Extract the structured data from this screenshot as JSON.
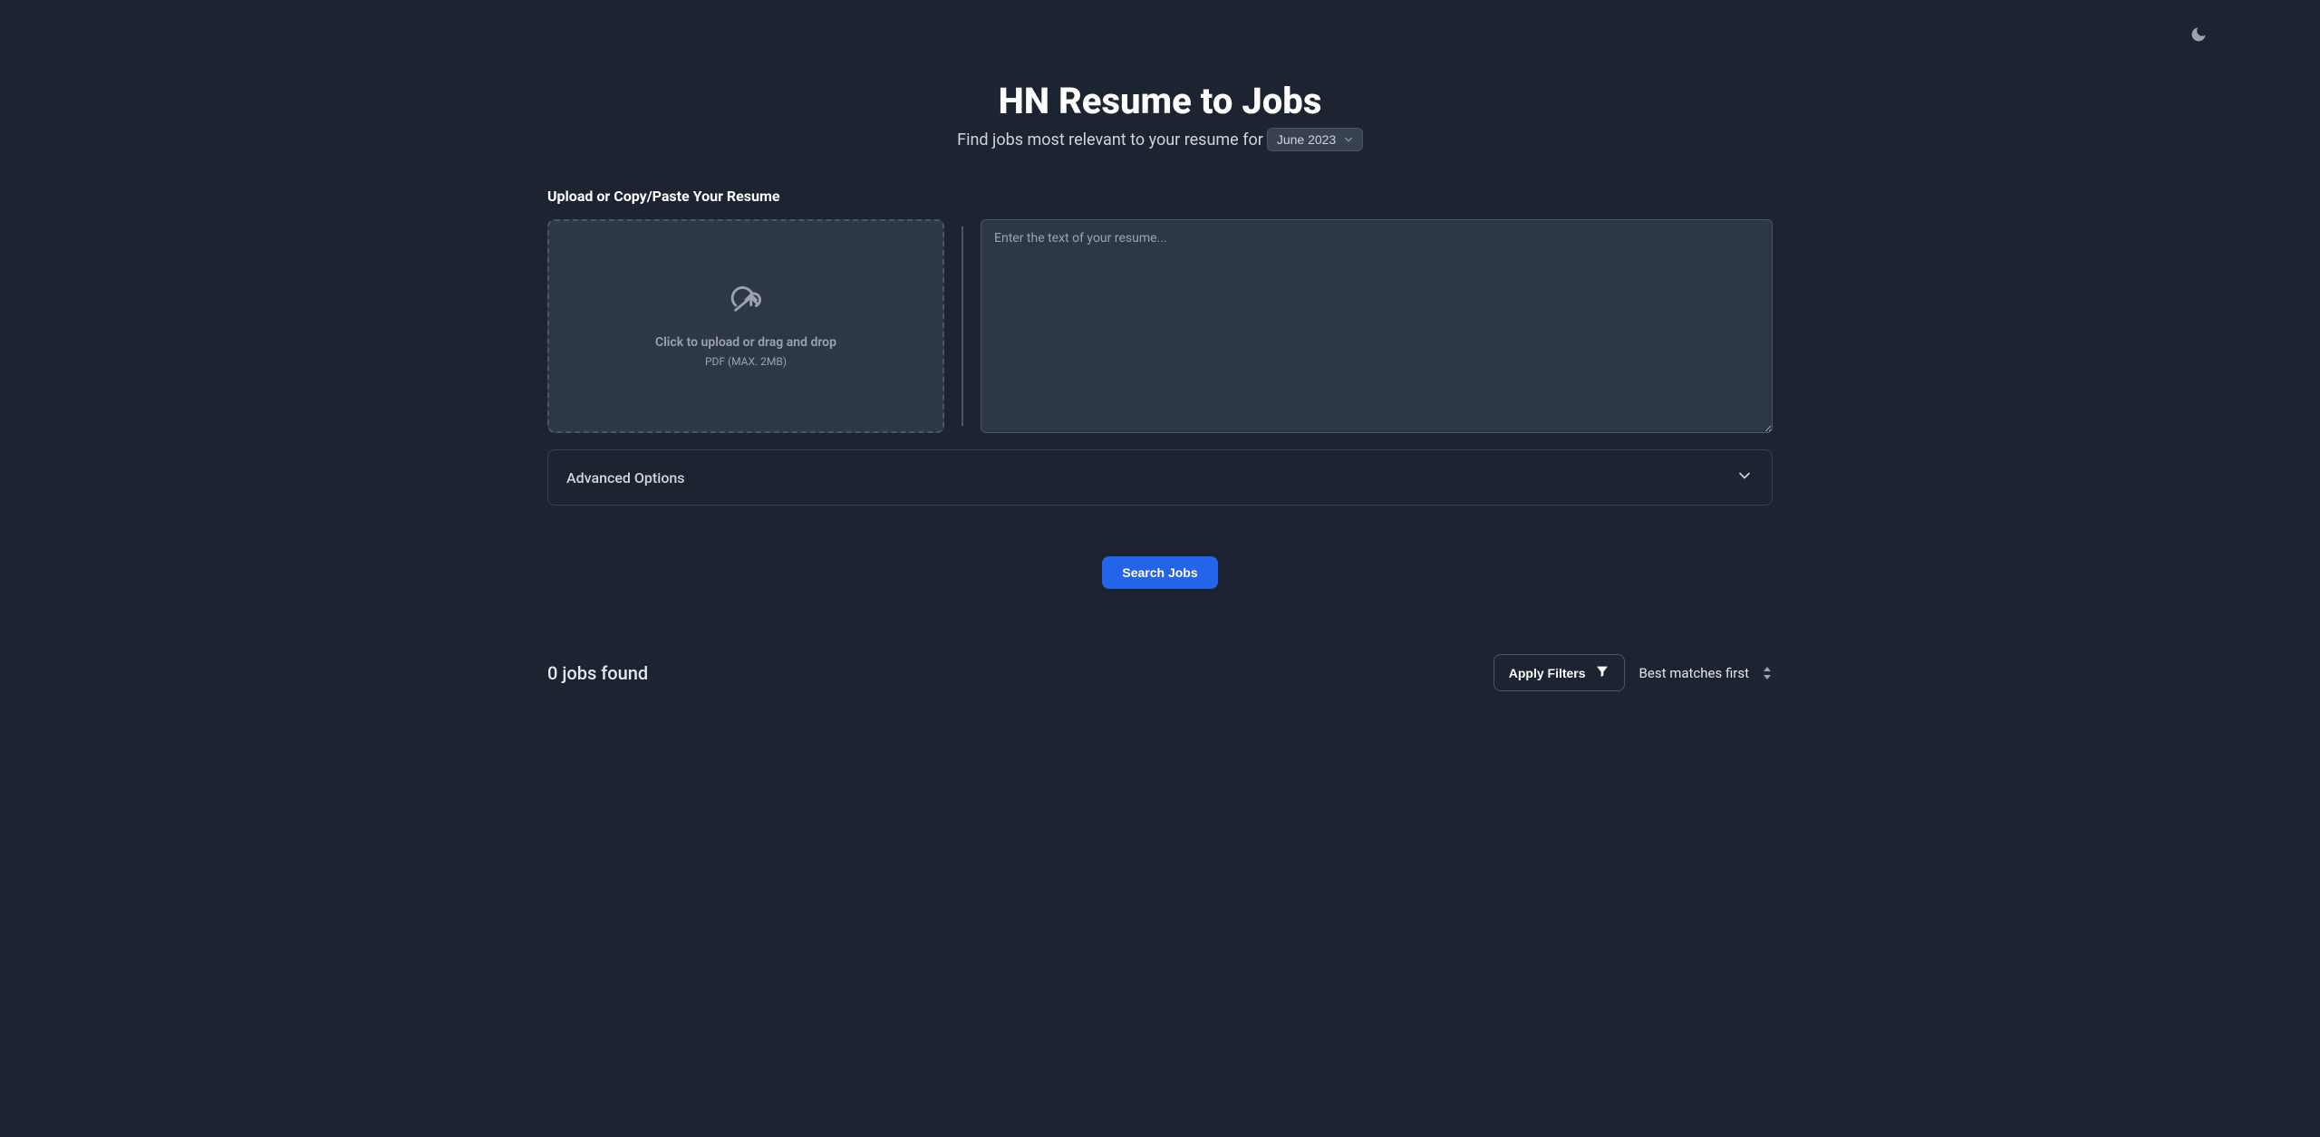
{
  "header": {
    "title": "HN Resume to Jobs",
    "subtitle_prefix": "Find jobs most relevant to your resume for",
    "month_selected": "June 2023"
  },
  "upload": {
    "section_label": "Upload or Copy/Paste Your Resume",
    "dropzone_primary": "Click to upload or drag and drop",
    "dropzone_secondary": "PDF (MAX. 2MB)",
    "textarea_placeholder": "Enter the text of your resume..."
  },
  "advanced": {
    "label": "Advanced Options"
  },
  "actions": {
    "search_label": "Search Jobs"
  },
  "results": {
    "count_text": "0 jobs found",
    "apply_filters_label": "Apply Filters",
    "sort_label": "Best matches first"
  }
}
